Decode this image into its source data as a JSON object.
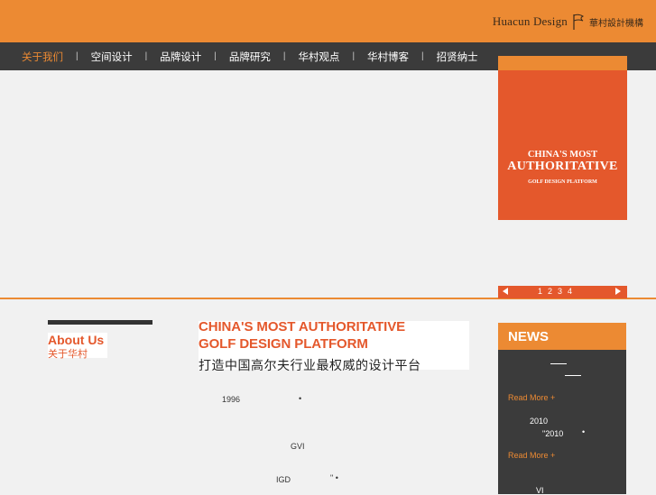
{
  "brand": {
    "name_en": "Huacun Design",
    "name_cn": "華村設計機構"
  },
  "nav": {
    "items": [
      {
        "label": "关于我们",
        "active": true
      },
      {
        "label": "空间设计"
      },
      {
        "label": "品牌设计"
      },
      {
        "label": "品牌研究"
      },
      {
        "label": "华村观点"
      },
      {
        "label": "华村博客"
      },
      {
        "label": "招贤纳士"
      }
    ],
    "separator": "|"
  },
  "promo": {
    "line1": "CHINA'S MOST",
    "line2": "AUTHORITATIVE",
    "line3": "GOLF  DESIGN PLATFORM"
  },
  "slider": {
    "pages": [
      "1",
      "2",
      "3",
      "4"
    ]
  },
  "about": {
    "title_en": "About Us",
    "title_cn": "关于华村"
  },
  "headline": {
    "line1": "CHINA'S MOST AUTHORITATIVE",
    "line2": "GOLF  DESIGN PLATFORM",
    "line_cn": "打造中国高尔夫行业最权威的设计平台"
  },
  "body": {
    "year": "1996",
    "dot": "•",
    "gvi": "GVI",
    "igd": "IGD",
    "quote": "\" •"
  },
  "news": {
    "title": "NEWS",
    "read_more_1": "Read More +",
    "year_1": "2010",
    "year_2": "\"2010",
    "dot_2": "•",
    "read_more_2": "Read More +",
    "tail": "VI"
  },
  "colors": {
    "brand_orange": "#ec8a33",
    "accent_red_orange": "#e4582c",
    "dark_gray": "#3b3b3b"
  }
}
